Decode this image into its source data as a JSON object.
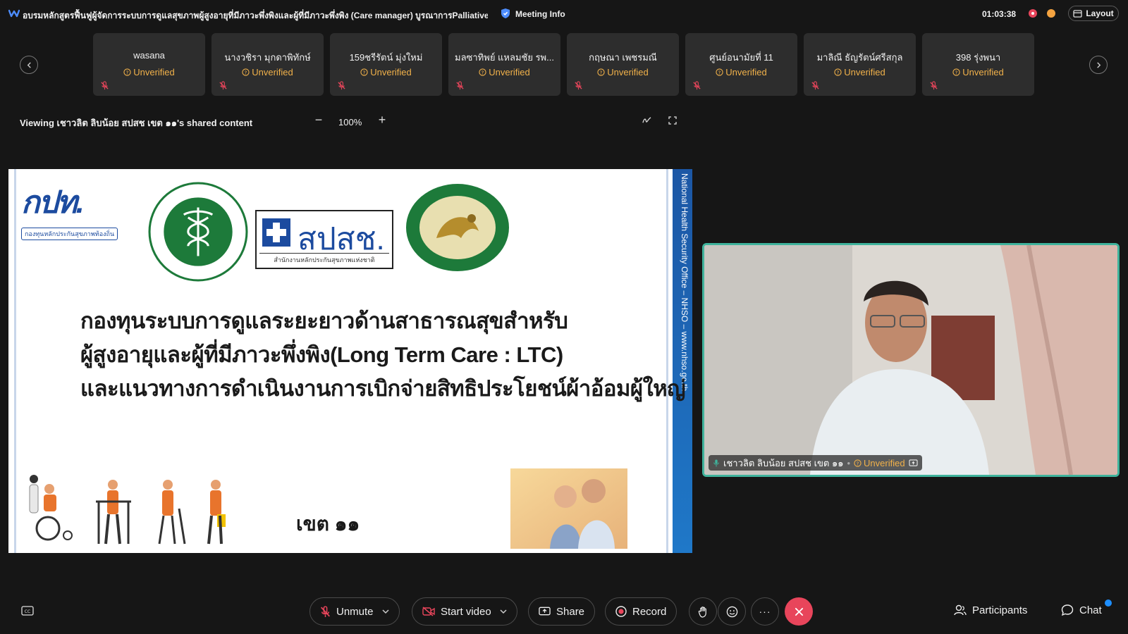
{
  "header": {
    "meeting_title": "อบรมหลักสูตรฟื้นฟูผู้จัดการระบบการดูแลสุขภาพผู้สูงอายุที่มีภาวะพึ่งพิงและผู้ที่มีภาวะพึ่งพิง (Care manager) บูรณาการPalliative c",
    "meeting_info_label": "Meeting Info",
    "timer": "01:03:38",
    "layout_label": "Layout"
  },
  "participants": [
    {
      "name": "wasana",
      "status": "Unverified"
    },
    {
      "name": "นางวชิรา มุกดาพิทักษ์",
      "status": "Unverified"
    },
    {
      "name": "159ชรีรัตน์  มุ่งใหม่",
      "status": "Unverified"
    },
    {
      "name": "มลซาทิพย์ แหลมชัย รพ...",
      "status": "Unverified"
    },
    {
      "name": "กฤษณา  เพชรมณี",
      "status": "Unverified"
    },
    {
      "name": "ศูนย์อนามัยที่ 11",
      "status": "Unverified"
    },
    {
      "name": "มาลิณี ธัญรัตน์ศรีสกุล",
      "status": "Unverified"
    },
    {
      "name": "398 รุ่งพนา",
      "status": "Unverified"
    }
  ],
  "share": {
    "viewing_text": "Viewing เชาวลิต ลิบน้อย สปสช เขต ๑๑'s shared content",
    "zoom_minus": "−",
    "zoom": "100%",
    "zoom_plus": "+"
  },
  "slide": {
    "logo_kpk": "กปท.",
    "logo_kpk_sub": "กองทุนหลักประกันสุขภาพท้องถิ่น",
    "logo_nhso": "สปสช.",
    "logo_nhso_sub": "สำนักงานหลักประกันสุขภาพแห่งชาติ",
    "side_strip": "National Health Security Office – NHSO – www.nhso.go.th",
    "title_line1": "กองทุนระบบการดูแลระยะยาวด้านสาธารณสุขสำหรับ",
    "title_line2": "ผู้สูงอายุและผู้ที่มีภาวะพึ่งพิง(Long Term Care : LTC)",
    "title_line3": "และแนวทางการดำเนินงานการเบิกจ่ายสิทธิประโยชน์ผ้าอ้อมผู้ใหญ่",
    "zone": "เขต ๑๑"
  },
  "speaker": {
    "name": "เชาวลิต ลิบน้อย สปสช เขต ๑๑",
    "separator": "•",
    "status": "Unverified"
  },
  "toolbar": {
    "unmute": "Unmute",
    "start_video": "Start video",
    "share": "Share",
    "record": "Record",
    "more": "···",
    "participants": "Participants",
    "chat": "Chat"
  },
  "colors": {
    "background": "#161616",
    "tile": "#2d2d2d",
    "unverified": "#f1b14a",
    "active_speaker_border": "#3fb39c",
    "leave": "#e8455b",
    "notification": "#1e8fff"
  }
}
